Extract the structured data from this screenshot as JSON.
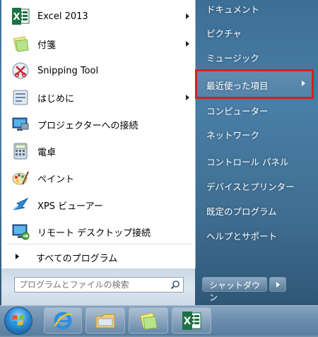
{
  "left_pane": {
    "programs": [
      {
        "label": "Excel 2013",
        "icon": "excel-icon",
        "has_arrow": true
      },
      {
        "label": "付箋",
        "icon": "sticky-notes-icon",
        "has_arrow": true
      },
      {
        "label": "Snipping Tool",
        "icon": "snipping-tool-icon",
        "has_arrow": false
      },
      {
        "label": "はじめに",
        "icon": "getting-started-icon",
        "has_arrow": true
      },
      {
        "label": "プロジェクターへの接続",
        "icon": "projector-icon",
        "has_arrow": false
      },
      {
        "label": "電卓",
        "icon": "calculator-icon",
        "has_arrow": false
      },
      {
        "label": "ペイント",
        "icon": "paint-icon",
        "has_arrow": false
      },
      {
        "label": "XPS ビューアー",
        "icon": "xps-viewer-icon",
        "has_arrow": false
      },
      {
        "label": "リモート デスクトップ接続",
        "icon": "remote-desktop-icon",
        "has_arrow": false
      }
    ],
    "all_programs": "すべてのプログラム"
  },
  "search": {
    "placeholder": "プログラムとファイルの検索"
  },
  "right_pane": {
    "items": [
      {
        "label": "ドキュメント"
      },
      {
        "label": "ピクチャ"
      },
      {
        "label": "ミュージック"
      },
      {
        "label": "最近使った項目",
        "has_arrow": true,
        "highlighted": true
      },
      {
        "label": "コンピューター"
      },
      {
        "label": "ネットワーク"
      },
      {
        "label": "コントロール パネル"
      },
      {
        "label": "デバイスとプリンター"
      },
      {
        "label": "既定のプログラム"
      },
      {
        "label": "ヘルプとサポート"
      }
    ]
  },
  "shutdown": {
    "label": "シャットダウン"
  },
  "taskbar": {
    "buttons": [
      "start-orb",
      "internet-explorer-icon",
      "file-explorer-icon",
      "sticky-notes-icon",
      "excel-icon"
    ]
  },
  "colors": {
    "highlight_outline": "#d61f1f"
  }
}
